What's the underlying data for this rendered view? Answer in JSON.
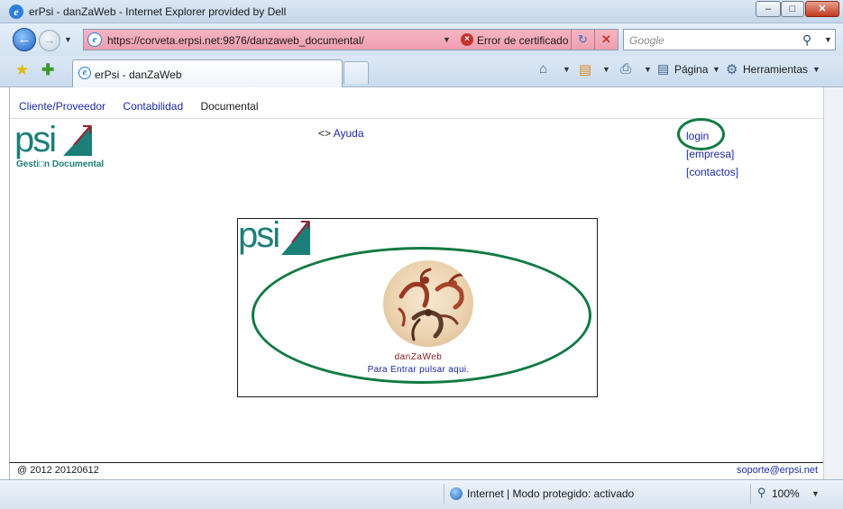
{
  "window": {
    "title": "erPsi - danZaWeb - Internet Explorer provided by Dell"
  },
  "address_bar": {
    "url": "https://corveta.erpsi.net:9876/danzaweb_documental/",
    "cert_error": "Error de certificado"
  },
  "search": {
    "placeholder": "Google"
  },
  "tab": {
    "label": "erPsi - danZaWeb"
  },
  "command_bar": {
    "page_label": "Página",
    "tools_label": "Herramientas"
  },
  "page": {
    "menu": [
      {
        "label": "Cliente/Proveedor"
      },
      {
        "label": "Contabilidad"
      },
      {
        "label": "Documental"
      }
    ],
    "logo_text": "psi",
    "logo_subtitle": "Gesti□n Documental",
    "help": {
      "arrows": "<>",
      "label": "Ayuda"
    },
    "right_links": {
      "login": "login",
      "empresa": "[empresa]",
      "contactos": "[contactos]"
    },
    "center": {
      "logo_text": "psi",
      "app_name": "danZaWeb",
      "enter_text": "Para Entrar pulsar aqui."
    },
    "footer": {
      "left": "@ 2012 20120612",
      "right": "soporte@erpsi.net"
    }
  },
  "status_bar": {
    "zone_text": "Internet | Modo protegido: activado",
    "zoom": "100%"
  },
  "colors": {
    "logo": "#1c7f78",
    "accent_red": "#a11d2e",
    "link": "#1a29a8",
    "annotation": "#127a42"
  },
  "icons": [
    "ie-icon",
    "back-icon",
    "forward-icon",
    "certificate-error-icon",
    "refresh-icon",
    "stop-icon",
    "search-icon",
    "favorites-star-icon",
    "add-favorites-icon",
    "home-icon",
    "feeds-icon",
    "print-icon",
    "page-icon",
    "gear-icon",
    "globe-icon",
    "zoom-icon"
  ]
}
